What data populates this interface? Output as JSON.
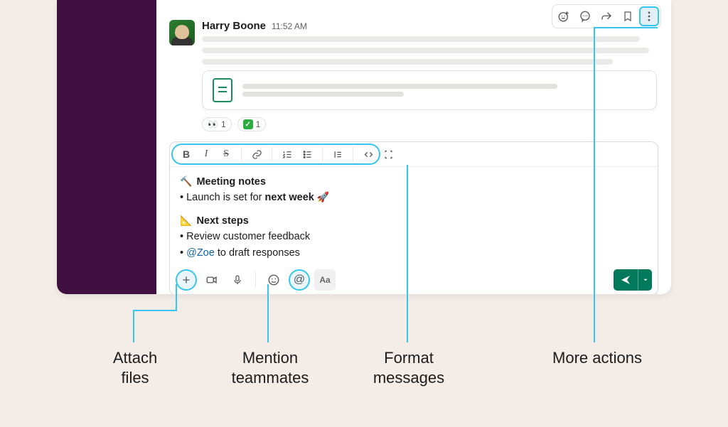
{
  "message": {
    "author": "Harry Boone",
    "time": "11:52 AM",
    "reactions": [
      {
        "icon": "eyes",
        "count": "1"
      },
      {
        "icon": "check",
        "count": "1"
      }
    ]
  },
  "actions": {
    "react": "Add reaction",
    "thread": "Reply in thread",
    "share": "Share",
    "bookmark": "Bookmark",
    "more": "More actions"
  },
  "composer": {
    "meeting_emoji": "🔨",
    "meeting_title": "Meeting notes",
    "meeting_line_prefix": "• Launch is set for ",
    "meeting_line_bold": "next week",
    "rocket": "🚀",
    "next_emoji": "📐",
    "next_title": "Next steps",
    "next_line1": "• Review customer feedback",
    "next_line2_bullet": "• ",
    "mention": "@Zoe",
    "next_line2_rest": " to draft responses",
    "aa_label": "Aa"
  },
  "annotations": {
    "attach": "Attach\nfiles",
    "mention": "Mention\nteammates",
    "format": "Format\nmessages",
    "more": "More actions"
  }
}
